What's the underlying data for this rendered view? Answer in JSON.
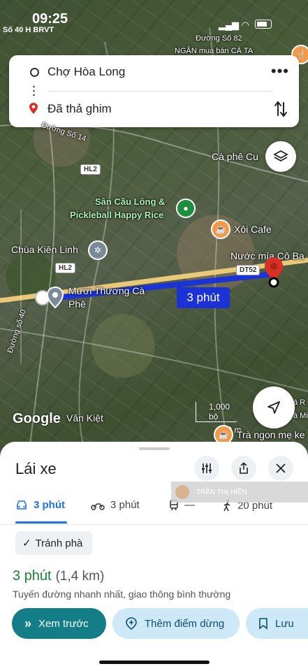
{
  "status_bar": {
    "time": "09:25",
    "carrier": "Số 40 H BRVT"
  },
  "route": {
    "origin": "Chợ Hòa Long",
    "destination": "Đã thả ghim"
  },
  "map": {
    "labels": {
      "duong_so_82": "Đường Số 82",
      "ngan_mua": "NGÂN mua bán CÀ TA",
      "duong_so_14": "Đường Số 14",
      "hl2_top": "HL2",
      "ca_phe_cu": "Cà phê Cu",
      "san_cau_long_1": "Sân Cầu Lông &",
      "san_cau_long_2": "Pickleball Happy Rice",
      "xoi_cafe": "Xôi Cafe",
      "chua_kien_linh": "Chùa Kiên Linh",
      "nuoc_mia": "Nước mía Cô Ba",
      "hl2_mid": "HL2",
      "dt52": "DT52",
      "muoi_thuong_1": "Mười Thương Cà",
      "muoi_thuong_2": "Phê",
      "duong_so_40": "Đường số 40",
      "van_kiet": "Văn Kiệt",
      "tra_ngon": "Trà ngon mẹ ke",
      "right_edge_1": "à R",
      "right_edge_2": "à Mi"
    },
    "route_time_badge": "3 phút",
    "scale_ft": "1,000 bộ",
    "scale_m": "200 m",
    "google_logo": "Google",
    "route_color": "#1a32d6"
  },
  "sheet": {
    "title": "Lái xe",
    "modes": [
      {
        "icon": "car-icon",
        "label": "3 phút",
        "active": true
      },
      {
        "icon": "motorbike-icon",
        "label": "3 phút",
        "active": false
      },
      {
        "icon": "transit-icon",
        "label": "—",
        "active": false
      },
      {
        "icon": "walk-icon",
        "label": "20 phút",
        "active": false
      }
    ],
    "overlay_name": "TRẦN THỊ HIỀN",
    "chip_label": "Tránh phà",
    "eta_time": "3 phút",
    "eta_distance": "(1,4 km)",
    "description": "Tuyến đường nhanh nhất, giao thông bình thường",
    "buttons": {
      "preview": "Xem trước",
      "add_stop": "Thêm điểm dừng",
      "save": "Lưu"
    }
  },
  "colors": {
    "accent_blue": "#1a73e8",
    "eta_green": "#188038",
    "primary_teal": "#137e88",
    "pin_red": "#d93025"
  }
}
